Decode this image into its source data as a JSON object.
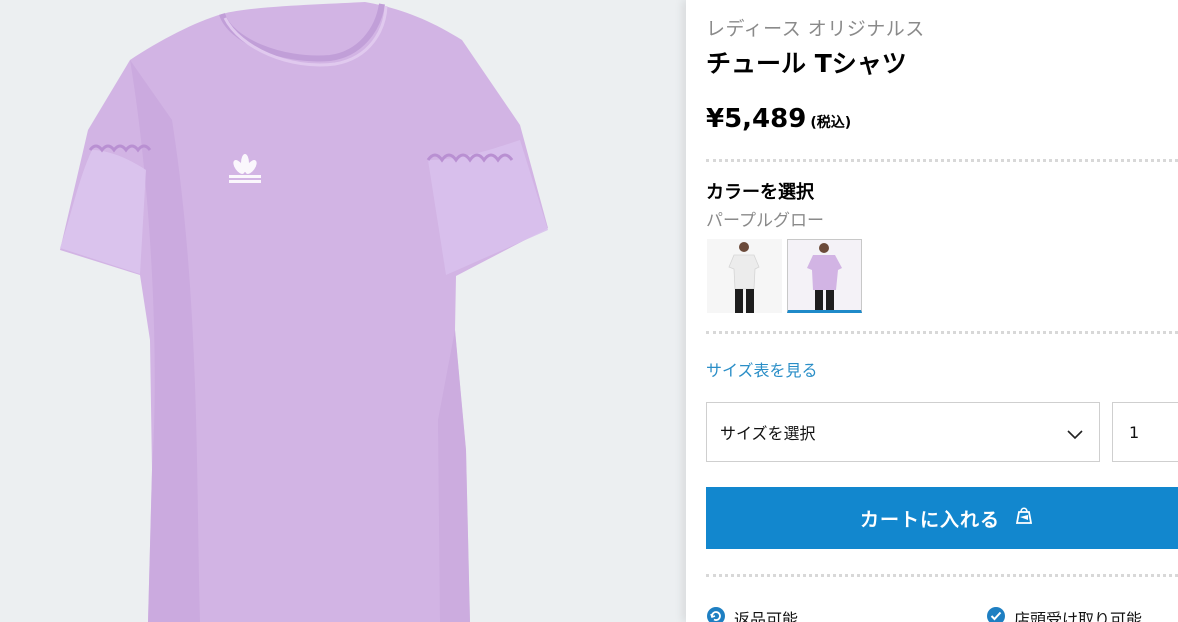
{
  "product": {
    "category": "レディース オリジナルス",
    "name": "チュール Tシャツ",
    "price": "¥5,489",
    "tax_note": "(税込)"
  },
  "color": {
    "heading": "カラーを選択",
    "selected_name": "パープルグロー",
    "swatches": [
      {
        "color": "#f2f2f2",
        "selected": false
      },
      {
        "color": "#d4b6e6",
        "selected": true
      }
    ]
  },
  "size": {
    "chart_link": "サイズ表を見る",
    "select_placeholder": "サイズを選択",
    "quantity": "1"
  },
  "cart": {
    "button_label": "カートに入れる"
  },
  "features": [
    {
      "label": "返品可能",
      "icon": "return-icon"
    },
    {
      "label": "店頭受け取り可能",
      "icon": "check-circle-icon"
    }
  ],
  "colors": {
    "accent": "#1287ce",
    "link": "#2a8ec7",
    "shirt": "#d4b6e6",
    "image_bg": "#eceff1"
  }
}
